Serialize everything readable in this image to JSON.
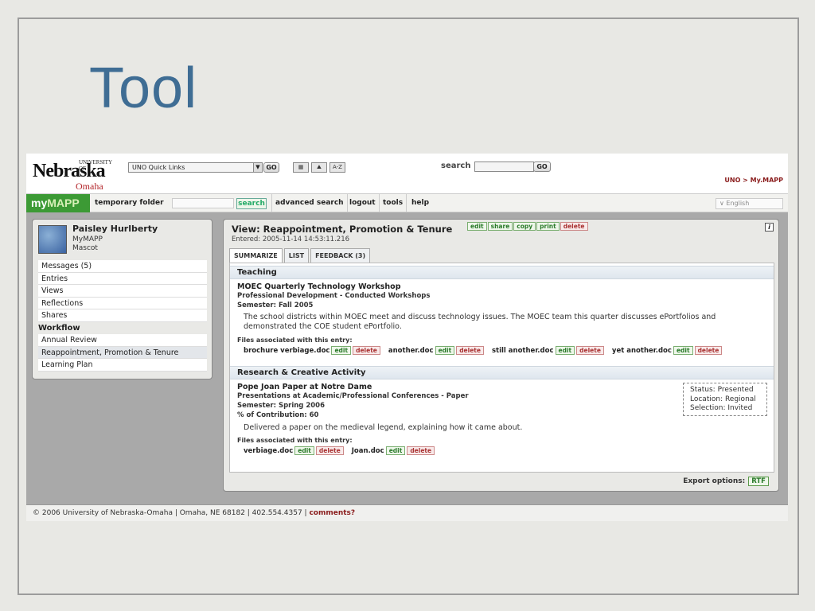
{
  "slide": {
    "title": "Tool"
  },
  "header": {
    "logo": {
      "univ": "UNIVERSITY OF",
      "main": "Nebraska",
      "sub": "Omaha"
    },
    "quick_links": "UNO Quick Links",
    "go_label": "GO",
    "tool_icons": [
      "keyboard-icon",
      "image-icon",
      "a-z-icon"
    ],
    "tool_icon_glyphs": [
      "▦",
      "⛰",
      "A-Z"
    ],
    "search_label": "search",
    "search_go": "GO",
    "breadcrumb": "UNO > My.MAPP"
  },
  "navbar": {
    "brand_lower": "my",
    "brand_upper": "MAPP",
    "items": [
      "temporary folder",
      "search",
      "advanced search",
      "logout",
      "tools",
      "help"
    ],
    "language": "English"
  },
  "sidebar": {
    "user_name": "Paisley Hurlberty",
    "user_role_line1": "MyMAPP",
    "user_role_line2": "Mascot",
    "items": [
      "Messages (5)",
      "Entries",
      "Views",
      "Reflections",
      "Shares"
    ],
    "workflow_label": "Workflow",
    "workflow_items": [
      "Annual Review",
      "Reappointment, Promotion & Tenure",
      "Learning Plan"
    ]
  },
  "main": {
    "view_title": "View: Reappointment, Promotion & Tenure",
    "actions": [
      "edit",
      "share",
      "copy",
      "print",
      "delete"
    ],
    "info_label": "i",
    "entered": "Entered: 2005-11-14 14:53:11.216",
    "tabs": [
      "SUMMARIZE",
      "LIST",
      "FEEDBACK (3)"
    ],
    "sections": [
      {
        "heading": "Teaching",
        "entry_title": "MOEC Quarterly Technology Workshop",
        "entry_type": "Professional Development - Conducted Workshops",
        "semester": "Semester: Fall 2005",
        "description": "The school districts within MOEC meet and discuss technology issues. The MOEC team this quarter discusses ePortfolios and demonstrated the COE student ePortfolio.",
        "files_label": "Files associated with this entry:",
        "files": [
          "brochure verbiage.doc",
          "another.doc",
          "still another.doc",
          "yet another.doc"
        ]
      },
      {
        "heading": "Research & Creative Activity",
        "entry_title": "Pope Joan Paper at Notre Dame",
        "entry_type": "Presentations at Academic/Professional Conferences - Paper",
        "semester": "Semester: Spring 2006",
        "contribution": "% of Contribution: 60",
        "description": "Delivered a paper on the medieval legend, explaining how it came about.",
        "files_label": "Files associated with this entry:",
        "files": [
          "verbiage.doc",
          "Joan.doc"
        ],
        "status": [
          "Status: Presented",
          "Location: Regional",
          "Selection: Invited"
        ]
      }
    ],
    "file_actions": [
      "edit",
      "delete"
    ],
    "export_label": "Export options:",
    "export_format": "RTF"
  },
  "footer": {
    "text": "© 2006 University of Nebraska-Omaha | Omaha, NE 68182 | 402.554.4357 | ",
    "comments": "comments?"
  }
}
